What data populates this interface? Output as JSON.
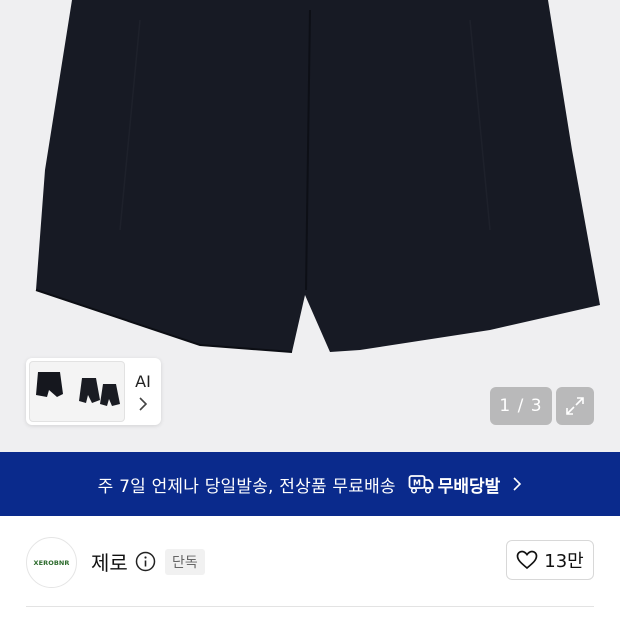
{
  "gallery": {
    "counter": "1 / 3",
    "thumb_label": "AI",
    "expand_icon": "expand-icon",
    "chevron_icon": "chevron-right-icon"
  },
  "banner": {
    "text": "주 7일 언제나 당일발송, 전상품 무료배송",
    "badge_text": "무배당발",
    "badge_icon": "delivery-truck-icon",
    "bg_color": "#0a2a8c"
  },
  "brand": {
    "logo_text": "XEROBNR",
    "name": "제로",
    "exclusive_badge": "단독",
    "like_count": "13만",
    "like_icon": "heart-icon"
  }
}
